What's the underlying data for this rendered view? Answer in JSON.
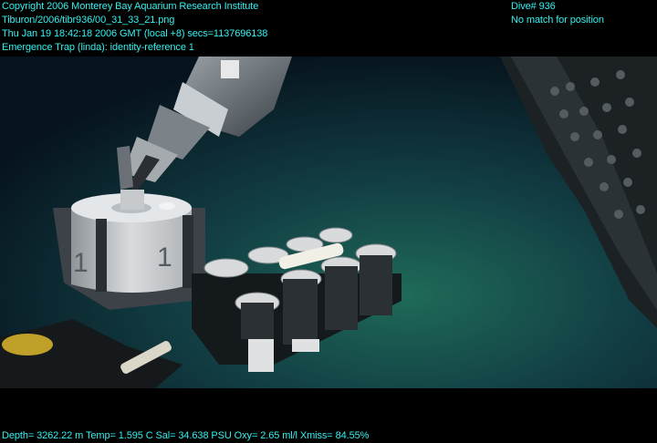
{
  "overlay": {
    "copyright": "Copyright 2006 Monterey Bay Aquarium Research Institute",
    "file_path": "Tiburon/2006/tibr936/00_31_33_21.png",
    "timestamp": "Thu Jan 19 18:42:18 2006 GMT (local +8)  secs=1137696138",
    "annotation": "Emergence Trap (linda): identity-reference 1",
    "dive": "Dive# 936",
    "position_status": "No match for position",
    "telemetry": "Depth= 3262.22 m  Temp= 1.595 C  Sal= 34.638 PSU  Oxy= 2.65 ml/l  Xmiss= 84.55%"
  },
  "scene": {
    "trap_label_left": "1",
    "trap_label_right": "1",
    "water_color": "#0d3a3a",
    "overlay_color": "#33f0f0"
  }
}
